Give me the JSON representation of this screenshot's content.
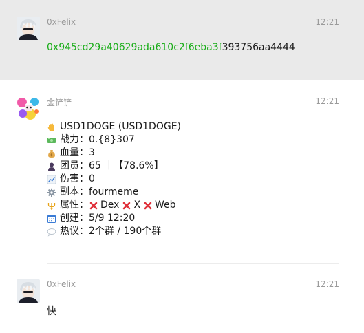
{
  "messages": [
    {
      "sender": "0xFelix",
      "time": "12:21",
      "avatar": "anime-avatar-white-hair",
      "text_link": "0x945cd29a40629ada610c2f6eba3f",
      "text_rest": "393756aa4444"
    },
    {
      "sender": "金铲铲",
      "time": "12:21",
      "avatar": "colorful-avatar",
      "lines": {
        "title": "USD1DOGE (USD1DOGE)",
        "power_label": "战力：",
        "power_value": "0.{8}307",
        "hp_label": "血量：",
        "hp_value": "3",
        "members_label": "团员：",
        "members_value": "65 ｜【78.6%】",
        "damage_label": "伤害：",
        "damage_value": "0",
        "dungeon_label": "副本：",
        "dungeon_value": "fourmeme",
        "attr_label": "属性：",
        "attr_items": [
          "Dex",
          "X",
          "Web"
        ],
        "created_label": "创建：",
        "created_value": "5/9 12:20",
        "talk_label": "热议：",
        "talk_value": "2个群 / 190个群"
      }
    },
    {
      "sender": "0xFelix",
      "time": "12:21",
      "avatar": "anime-avatar-white-hair",
      "text": "快"
    }
  ],
  "colors": {
    "highlight_bg": "#eaeaea",
    "link": "#1aad19",
    "meta": "#9a9a9a",
    "x_red": "#e0303a"
  }
}
